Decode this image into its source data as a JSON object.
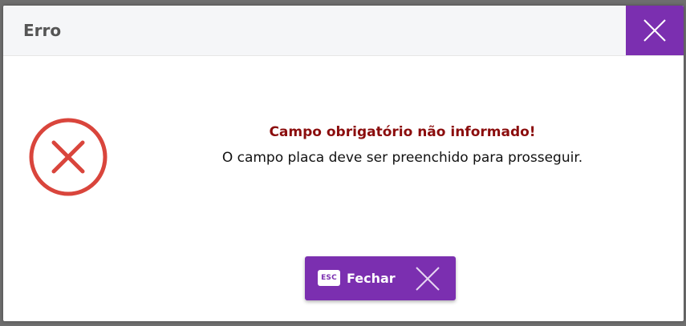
{
  "dialog": {
    "title": "Erro",
    "close_icon": "close-icon",
    "status_icon": "error-circle-icon",
    "message_title": "Campo obrigatório não informado!",
    "message_body": "O campo placa deve ser preenchido para prosseguir.",
    "close_button": {
      "shortcut": "ESC",
      "label": "Fechar",
      "icon": "close-icon"
    }
  },
  "colors": {
    "accent": "#7b2fb0",
    "error_icon": "#d9453c",
    "message_title": "#8b0d0d"
  }
}
